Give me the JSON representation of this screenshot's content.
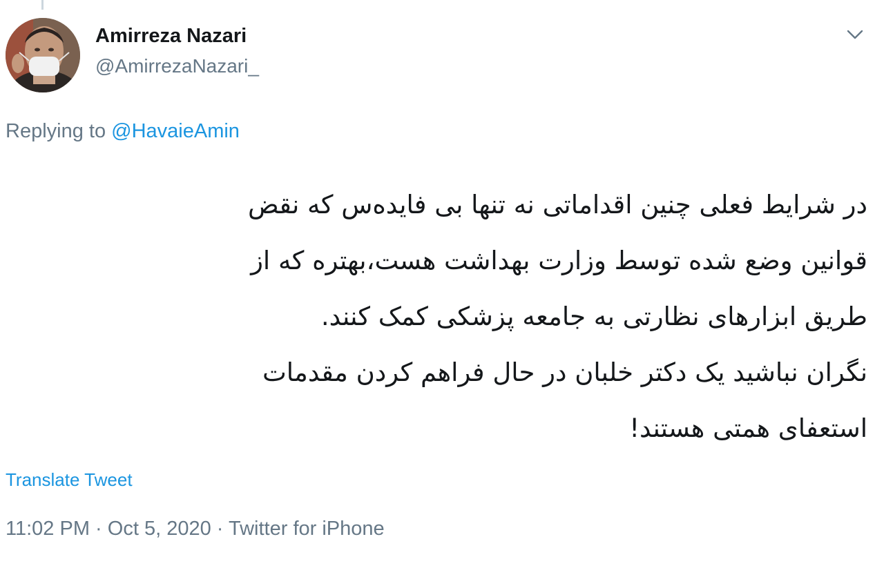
{
  "author": {
    "name": "Amirreza Nazari",
    "handle": "@AmirrezaNazari_"
  },
  "reply": {
    "prefix": "Replying to",
    "mention": "@HavaieAmin"
  },
  "tweet": {
    "lines": [
      "در شرایط فعلی چنین اقداماتی نه تنها بی فایده‌س که نقض",
      "قوانین وضع شده توسط وزارت بهداشت هست،بهتره که از",
      "طریق ابزارهای نظارتی به جامعه پزشکی کمک کنند.",
      "نگران نباشید یک دکتر خلبان در حال فراهم کردن مقدمات",
      "استعفای همتی هستند!"
    ]
  },
  "actions": {
    "translate": "Translate Tweet"
  },
  "meta": {
    "time": "11:02 PM",
    "date": "Oct 5, 2020",
    "source": "Twitter for iPhone",
    "separator": "·"
  },
  "icons": {
    "menu": "chevron-down-icon",
    "profile": "avatar"
  },
  "colors": {
    "link": "#1b95e0",
    "secondary": "#657786",
    "text": "#14171a"
  }
}
